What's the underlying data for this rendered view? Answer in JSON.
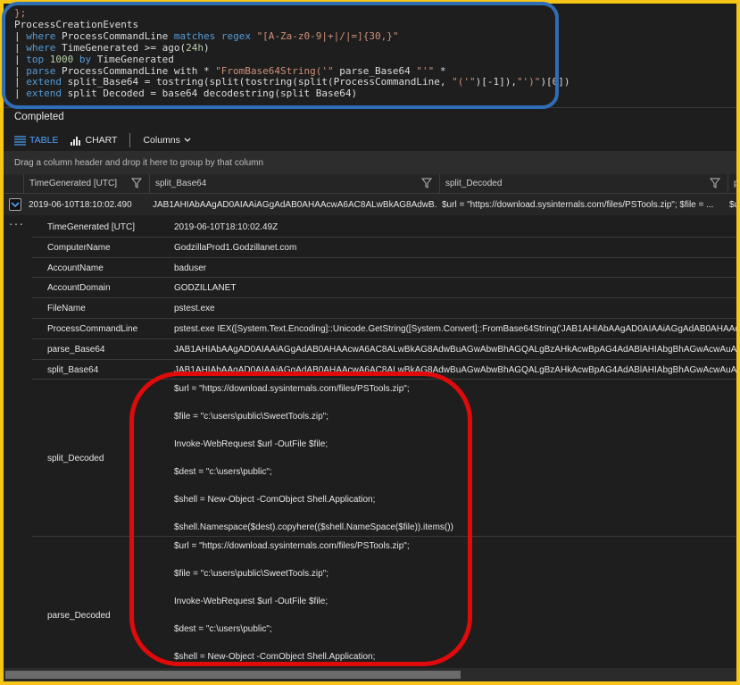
{
  "query": {
    "lines": [
      [
        {
          "t": "};",
          "c": "str"
        }
      ],
      [
        {
          "t": "ProcessCreationEvents",
          "c": "pipe"
        }
      ],
      [
        {
          "t": "| ",
          "c": "pipe"
        },
        {
          "t": "where ",
          "c": "kw"
        },
        {
          "t": "ProcessCommandLine ",
          "c": "pipe"
        },
        {
          "t": "matches regex ",
          "c": "kw"
        },
        {
          "t": "\"[A-Za-z0-9|+|/|=]{30,}\"",
          "c": "str"
        }
      ],
      [
        {
          "t": "| ",
          "c": "pipe"
        },
        {
          "t": "where ",
          "c": "kw"
        },
        {
          "t": "TimeGenerated >= ago(",
          "c": "pipe"
        },
        {
          "t": "24h",
          "c": "num"
        },
        {
          "t": ")",
          "c": "pipe"
        }
      ],
      [
        {
          "t": "| ",
          "c": "pipe"
        },
        {
          "t": "top ",
          "c": "kw"
        },
        {
          "t": "1000 ",
          "c": "num"
        },
        {
          "t": "by ",
          "c": "kw"
        },
        {
          "t": "TimeGenerated",
          "c": "pipe"
        }
      ],
      [
        {
          "t": "| ",
          "c": "pipe"
        },
        {
          "t": "parse ",
          "c": "kw"
        },
        {
          "t": "ProcessCommandLine with * ",
          "c": "pipe"
        },
        {
          "t": "\"FromBase64String('\"",
          "c": "str"
        },
        {
          "t": " parse_Base64 ",
          "c": "pipe"
        },
        {
          "t": "\"'\"",
          "c": "str"
        },
        {
          "t": " *",
          "c": "pipe"
        }
      ],
      [
        {
          "t": "| ",
          "c": "pipe"
        },
        {
          "t": "extend ",
          "c": "kw"
        },
        {
          "t": "split_Base64 = tostring(split(tostring(split(ProcessCommandLine, ",
          "c": "pipe"
        },
        {
          "t": "\"('\"",
          "c": "str"
        },
        {
          "t": ")[-1]),",
          "c": "pipe"
        },
        {
          "t": "\"')\"",
          "c": "str"
        },
        {
          "t": ")[0])",
          "c": "pipe"
        }
      ],
      [
        {
          "t": "| ",
          "c": "pipe"
        },
        {
          "t": "extend ",
          "c": "kw"
        },
        {
          "t": "split Decoded = base64 decodestring(split Base64)",
          "c": "pipe"
        }
      ]
    ]
  },
  "status": "Completed",
  "toolbar": {
    "table": "TABLE",
    "chart": "CHART",
    "columns": "Columns"
  },
  "groupbar": "Drag a column header and drop it here to group by that column",
  "columns": [
    "TimeGenerated [UTC]",
    "split_Base64",
    "split_Decoded",
    "p"
  ],
  "row": {
    "time": "2019-06-10T18:10:02.490",
    "base64": "JAB1AHIAbAAgAD0AIAAiAGgAdAB0AHAAcwA6AC8ALwBkAG8AdwB...",
    "decoded": "$url = \"https://download.sysinternals.com/files/PSTools.zip\"; $file = ...",
    "p": "$u"
  },
  "details": [
    {
      "label": "TimeGenerated [UTC]",
      "value": "2019-06-10T18:10:02.49Z"
    },
    {
      "label": "ComputerName",
      "value": "GodzillaProd1.Godzillanet.com"
    },
    {
      "label": "AccountName",
      "value": "baduser"
    },
    {
      "label": "AccountDomain",
      "value": "GODZILLANET"
    },
    {
      "label": "FileName",
      "value": "pstest.exe"
    },
    {
      "label": "ProcessCommandLine",
      "value": "pstest.exe  IEX([System.Text.Encoding]::Unicode.GetString([System.Convert]::FromBase64String('JAB1AHIAbAAgAD0AIAAiAGgAdAB0AHAAcwA6"
    },
    {
      "label": "parse_Base64",
      "value": "JAB1AHIAbAAgAD0AIAAiAGgAdAB0AHAAcwA6AC8ALwBkAG8AdwBuAGwAbwBhAGQALgBzAHkAcwBpAG4AdABlAHIAbgBhAGwAcwAuAGMAb"
    },
    {
      "label": "split_Base64",
      "value": "JAB1AHIAbAAgAD0AIAAiAGgAdAB0AHAAcwA6AC8ALwBkAG8AdwBuAGwAbwBhAGQALgBzAHkAcwBpAG4AdABlAHIAbgBhAGwAcwAuAGMAb"
    }
  ],
  "split_decoded": {
    "label": "split_Decoded",
    "lines": [
      "$url = \"https://download.sysinternals.com/files/PSTools.zip\";",
      "$file = \"c:\\users\\public\\SweetTools.zip\";",
      "Invoke-WebRequest $url -OutFile $file;",
      "$dest = \"c:\\users\\public\";",
      "$shell = New-Object -ComObject Shell.Application;",
      "$shell.Namespace($dest).copyhere(($shell.NameSpace($file)).items())"
    ]
  },
  "parse_decoded": {
    "label": "parse_Decoded",
    "lines": [
      "$url = \"https://download.sysinternals.com/files/PSTools.zip\";",
      "$file = \"c:\\users\\public\\SweetTools.zip\";",
      "Invoke-WebRequest $url -OutFile $file;",
      "$dest = \"c:\\users\\public\";",
      "$shell = New-Object -ComObject Shell.Application;"
    ]
  },
  "colors": {
    "highlight_blue": "#2f6db5",
    "highlight_red": "#e00a0a",
    "frame": "#f5c518"
  }
}
